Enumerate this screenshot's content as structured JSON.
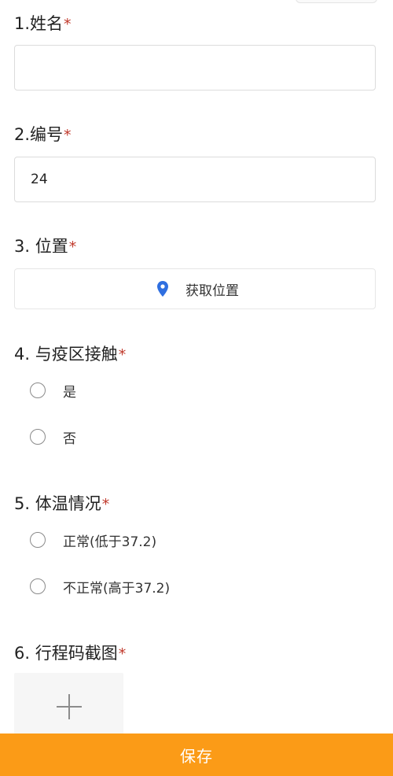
{
  "colors": {
    "accent": "#fb9b17",
    "required": "#c0392b",
    "pin": "#2f6fe0"
  },
  "form": {
    "q1": {
      "title": "1.姓名",
      "required": "*",
      "value": ""
    },
    "q2": {
      "title": "2.编号",
      "required": "*",
      "value": "24"
    },
    "q3": {
      "title": "3. 位置",
      "required": "*",
      "button_label": "获取位置",
      "icon": "location-pin-icon"
    },
    "q4": {
      "title": "4. 与疫区接触",
      "required": "*",
      "options": [
        "是",
        "否"
      ]
    },
    "q5": {
      "title": "5. 体温情况",
      "required": "*",
      "options": [
        "正常(低于37.2)",
        "不正常(高于37.2)"
      ]
    },
    "q6": {
      "title": "6. 行程码截图",
      "required": "*",
      "upload_icon": "plus-icon"
    }
  },
  "footer": {
    "save_label": "保存"
  }
}
